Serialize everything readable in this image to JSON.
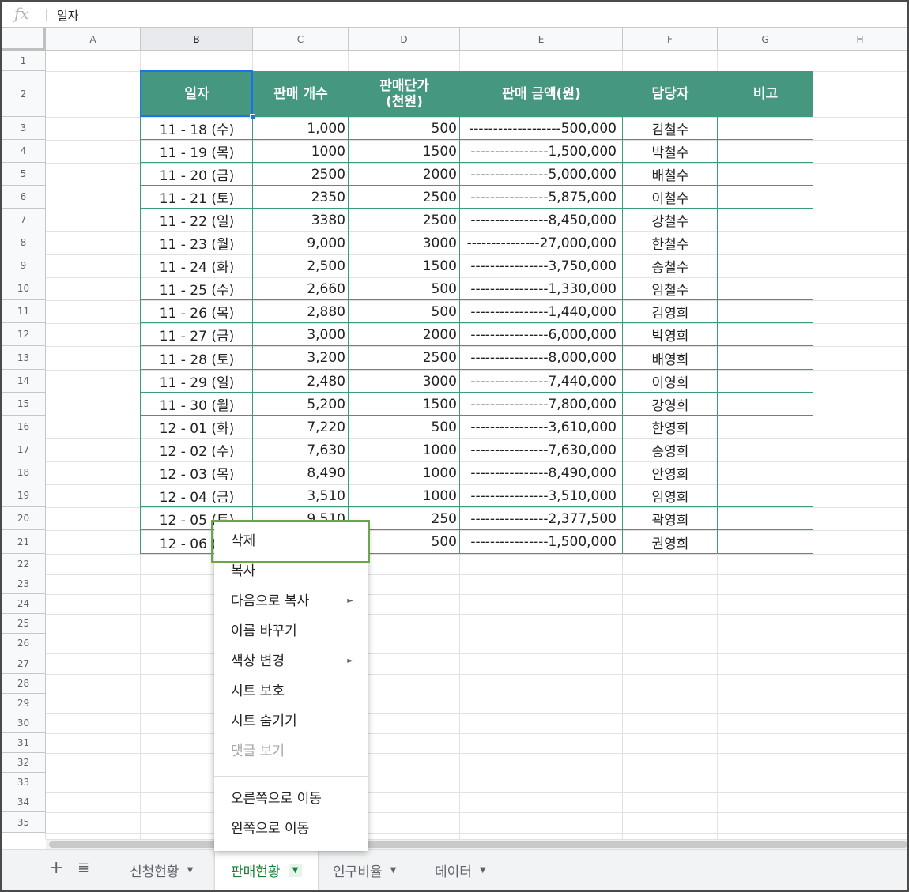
{
  "formula_bar": {
    "fx_label": "fx",
    "value": "일자"
  },
  "columns": [
    "A",
    "B",
    "C",
    "D",
    "E",
    "F",
    "G",
    "H"
  ],
  "selected_column": "B",
  "row_numbers": [
    "1",
    "2",
    "3",
    "4",
    "5",
    "6",
    "7",
    "8",
    "9",
    "10",
    "11",
    "12",
    "13",
    "14",
    "15",
    "16",
    "17",
    "18",
    "19",
    "20",
    "21",
    "22",
    "23",
    "24",
    "25",
    "26",
    "27",
    "28",
    "29",
    "30",
    "31",
    "32",
    "33",
    "34",
    "35"
  ],
  "table": {
    "headers": [
      "일자",
      "판매 개수",
      "판매단가\n(천원)",
      "판매 금액(원)",
      "담당자",
      "비고"
    ],
    "header_color": "#45977f",
    "rows": [
      [
        "11 - 18  (수)",
        "1,000",
        "500",
        "-------------------500,000",
        "김철수",
        ""
      ],
      [
        "11 - 19  (목)",
        "1000",
        "1500",
        "----------------1,500,000",
        "박철수",
        ""
      ],
      [
        "11 - 20  (금)",
        "2500",
        "2000",
        "----------------5,000,000",
        "배철수",
        ""
      ],
      [
        "11 - 21  (토)",
        "2350",
        "2500",
        "----------------5,875,000",
        "이철수",
        ""
      ],
      [
        "11 - 22  (일)",
        "3380",
        "2500",
        "----------------8,450,000",
        "강철수",
        ""
      ],
      [
        "11 - 23  (월)",
        "9,000",
        "3000",
        "---------------27,000,000",
        "한철수",
        ""
      ],
      [
        "11 - 24  (화)",
        "2,500",
        "1500",
        "----------------3,750,000",
        "송철수",
        ""
      ],
      [
        "11 - 25  (수)",
        "2,660",
        "500",
        "----------------1,330,000",
        "임철수",
        ""
      ],
      [
        "11 - 26  (목)",
        "2,880",
        "500",
        "----------------1,440,000",
        "김영희",
        ""
      ],
      [
        "11 - 27  (금)",
        "3,000",
        "2000",
        "----------------6,000,000",
        "박영희",
        ""
      ],
      [
        "11 - 28  (토)",
        "3,200",
        "2500",
        "----------------8,000,000",
        "배영희",
        ""
      ],
      [
        "11 - 29  (일)",
        "2,480",
        "3000",
        "----------------7,440,000",
        "이영희",
        ""
      ],
      [
        "11 - 30  (월)",
        "5,200",
        "1500",
        "----------------7,800,000",
        "강영희",
        ""
      ],
      [
        "12 - 01  (화)",
        "7,220",
        "500",
        "----------------3,610,000",
        "한영희",
        ""
      ],
      [
        "12 - 02  (수)",
        "7,630",
        "1000",
        "----------------7,630,000",
        "송영희",
        ""
      ],
      [
        "12 - 03  (목)",
        "8,490",
        "1000",
        "----------------8,490,000",
        "안영희",
        ""
      ],
      [
        "12 - 04  (금)",
        "3,510",
        "1000",
        "----------------3,510,000",
        "임영희",
        ""
      ],
      [
        "12 - 05  (토)",
        "9,510",
        "250",
        "----------------2,377,500",
        "곽영희",
        ""
      ],
      [
        "12 - 06  (일)",
        "",
        "500",
        "----------------1,500,000",
        "권영희",
        ""
      ]
    ]
  },
  "context_menu": {
    "items": [
      {
        "label": "삭제",
        "submenu": false,
        "disabled": false
      },
      {
        "label": "복사",
        "submenu": false,
        "disabled": false
      },
      {
        "label": "다음으로 복사",
        "submenu": true,
        "disabled": false
      },
      {
        "label": "이름 바꾸기",
        "submenu": false,
        "disabled": false
      },
      {
        "label": "색상 변경",
        "submenu": true,
        "disabled": false
      },
      {
        "label": "시트 보호",
        "submenu": false,
        "disabled": false
      },
      {
        "label": "시트 숨기기",
        "submenu": false,
        "disabled": false
      },
      {
        "label": "댓글 보기",
        "submenu": false,
        "disabled": true
      }
    ],
    "items2": [
      {
        "label": "오른쪽으로 이동",
        "submenu": false,
        "disabled": false
      },
      {
        "label": "왼쪽으로 이동",
        "submenu": false,
        "disabled": false
      }
    ],
    "submenu_glyph": "►",
    "highlight_color": "#6aa64b"
  },
  "sheet_tabs": {
    "add_icon": "plus-icon",
    "list_icon": "list-icon",
    "tabs": [
      {
        "label": "신청현황",
        "active": false
      },
      {
        "label": "판매현황",
        "active": true
      },
      {
        "label": "인구비율",
        "active": false
      },
      {
        "label": "데이터",
        "active": false
      }
    ],
    "dropdown_glyph": "▼",
    "active_color": "#188038"
  }
}
